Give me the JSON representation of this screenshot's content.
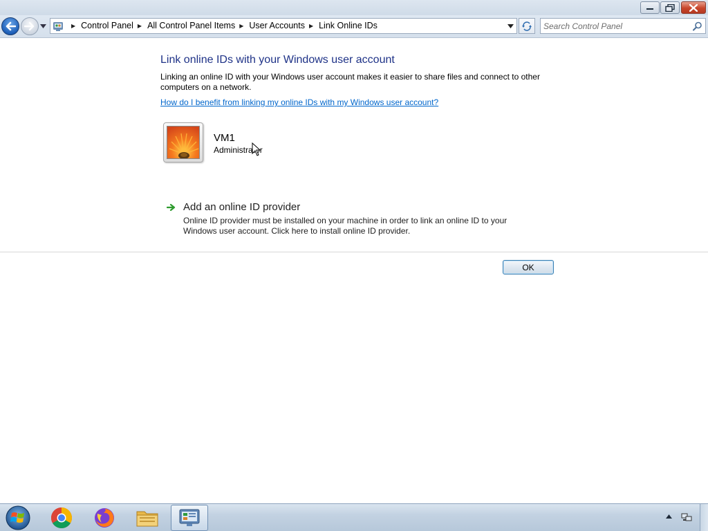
{
  "window": {
    "controls": {
      "minimize_icon": "minimize-icon",
      "maximize_icon": "restore-icon",
      "close_icon": "close-icon"
    }
  },
  "navigation": {
    "back_icon": "back-arrow-icon",
    "forward_icon": "forward-arrow-icon",
    "breadcrumbs": [
      "Control Panel",
      "All Control Panel Items",
      "User Accounts",
      "Link Online IDs"
    ],
    "search_placeholder": "Search Control Panel"
  },
  "main": {
    "heading": "Link online IDs with your Windows user account",
    "description": "Linking an online ID with your Windows user account makes it easier to share files and connect to other computers on a network.",
    "help_link": "How do I benefit from linking my online IDs with my Windows user account?",
    "user": {
      "name": "VM1",
      "role": "Administrator"
    },
    "add_provider": {
      "title": "Add an online ID provider",
      "description": "Online ID provider must be installed on your machine in order to link an online ID to your Windows user account. Click here to install online ID provider."
    },
    "ok_label": "OK"
  },
  "taskbar": {
    "apps": [
      "chrome-icon",
      "firefox-icon",
      "file-explorer-icon",
      "control-panel-icon"
    ],
    "active_app": "control-panel-icon"
  },
  "colors": {
    "heading": "#1e3287",
    "link": "#0066cc",
    "accent_arrow": "#2e9b2e"
  }
}
